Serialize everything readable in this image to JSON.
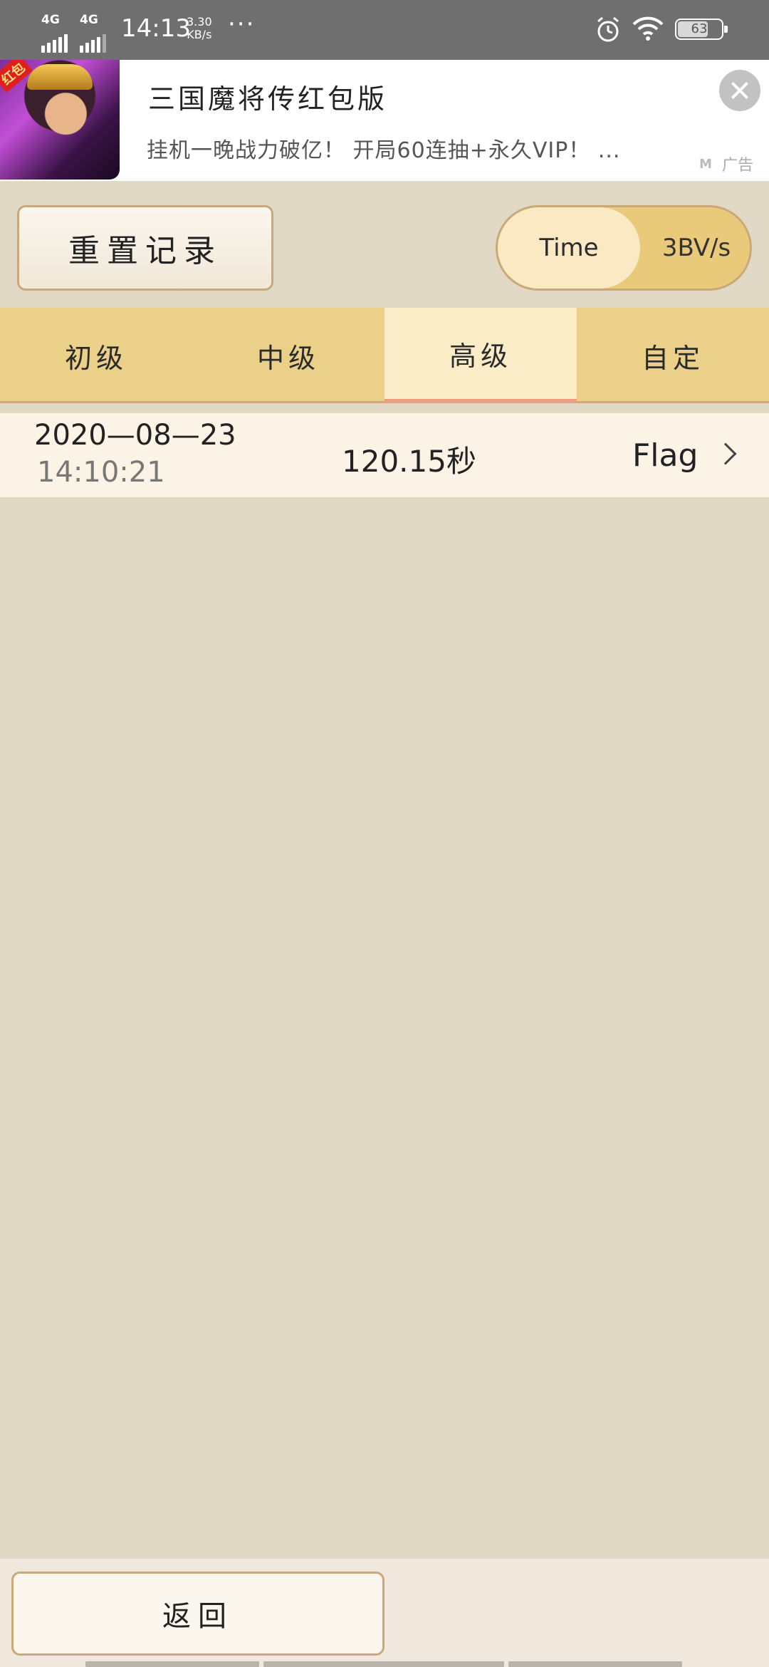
{
  "status_bar": {
    "network1": "4G",
    "network2": "4G",
    "time": "14:13",
    "speed_value": "3.30",
    "speed_unit": "KB/s",
    "more": "···",
    "battery": "63"
  },
  "ad": {
    "thumb_tag": "红包",
    "title": "三国魔将传红包版",
    "description": "挂机一晚战力破亿！ 开局60连抽+永久VIP！ ...",
    "label": "广告",
    "logo": "M"
  },
  "toolbar": {
    "reset_label": "重置记录",
    "sort_options": [
      "Time",
      "3BV/s"
    ],
    "sort_selected": "Time"
  },
  "tabs": [
    {
      "label": "初级",
      "active": false
    },
    {
      "label": "中级",
      "active": false
    },
    {
      "label": "高级",
      "active": true
    },
    {
      "label": "自定",
      "active": false
    }
  ],
  "records": [
    {
      "date": "2020—08—23",
      "time": "14:10:21",
      "score": "120.15秒",
      "mode": "Flag"
    }
  ],
  "footer": {
    "back_label": "返回"
  },
  "colors": {
    "page_bg": "#e2d8c6",
    "tab_bg": "#ead088",
    "tab_active_bg": "#fbecc8",
    "row_bg": "#fbf3e6",
    "button_border": "#c9a97a"
  }
}
